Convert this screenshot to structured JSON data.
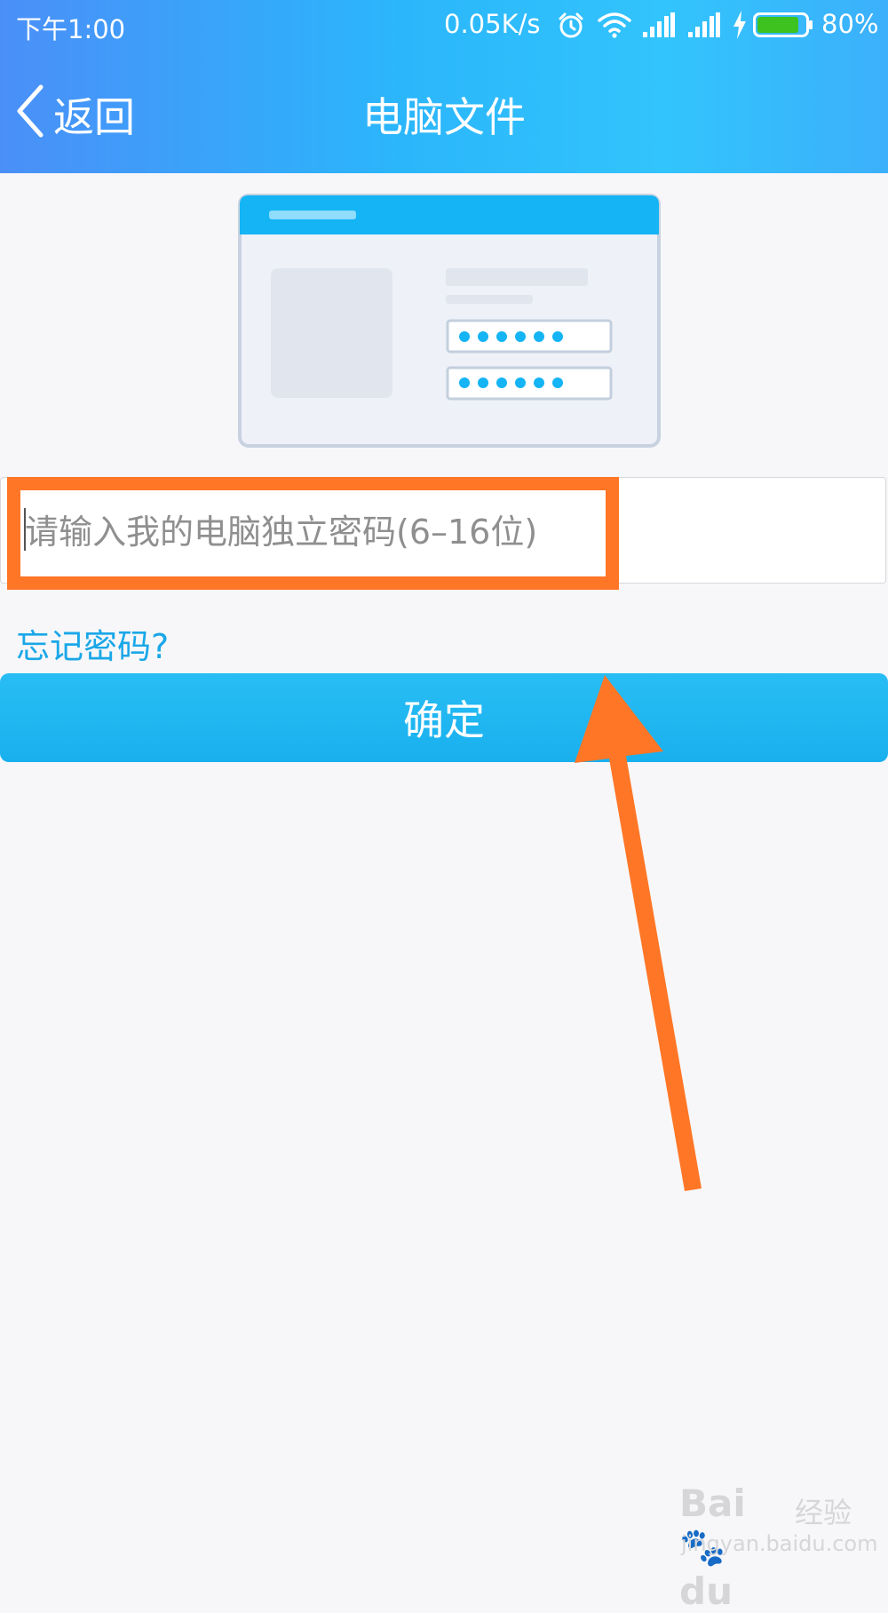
{
  "status_bar": {
    "time": "下午1:00",
    "net_speed": "0.05K/s",
    "battery_percent": "80%",
    "battery_level": 0.8,
    "icons": [
      "alarm-icon",
      "wifi-icon",
      "signal-icon",
      "signal-icon",
      "charging-icon",
      "battery-icon"
    ]
  },
  "nav": {
    "back_label": "返回",
    "title": "电脑文件"
  },
  "form": {
    "password_placeholder": "请输入我的电脑独立密码(6–16位)",
    "password_value": "",
    "forgot_link": "忘记密码?",
    "confirm_button": "确定"
  },
  "watermark": {
    "brand": "Baidu经验",
    "logo_text": "Bai",
    "logo_suffix": "du",
    "text": "经验",
    "url": "jingyan.baidu.com"
  },
  "colors": {
    "header_gradient": [
      "#4a8ff8",
      "#32c4fc"
    ],
    "accent": "#1aa7e8",
    "button": "#20b6f1",
    "annotation": "#ff7626"
  }
}
